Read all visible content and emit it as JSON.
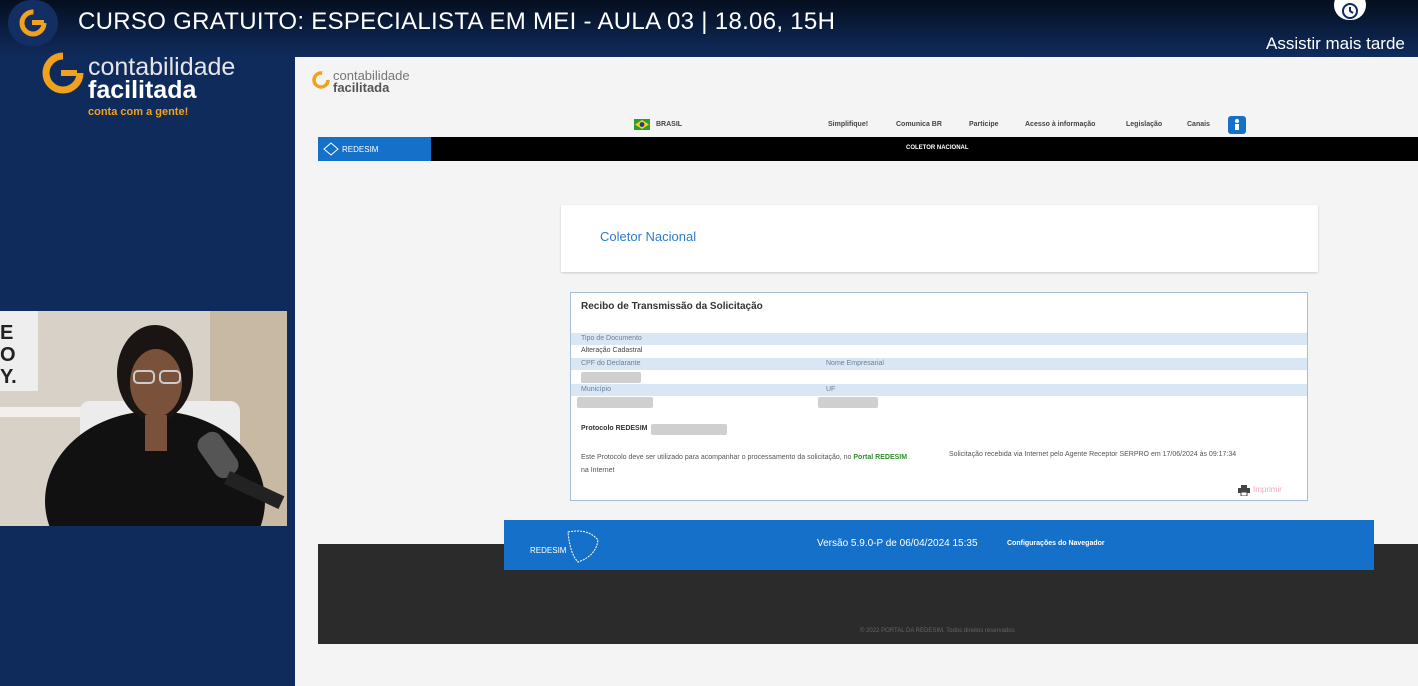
{
  "video": {
    "title": "CURSO GRATUITO: ESPECIALISTA EM MEI - AULA 03 | 18.06, 15H",
    "watch_later": "Assistir mais tarde"
  },
  "brand": {
    "line1": "contabilidade",
    "line2": "facilitada",
    "tagline": "conta com a gente!",
    "accent_color": "#f0a21c"
  },
  "share": {
    "logo_line1": "contabilidade",
    "logo_line2": "facilitada",
    "gov": {
      "country": "BRASIL",
      "links": [
        "Simplifique!",
        "Comunica BR",
        "Participe",
        "Acesso à informação",
        "Legislação",
        "Canais"
      ]
    },
    "redesim_tab": "REDESIM",
    "coletor_top": "COLETOR NACIONAL",
    "page_title": "Coletor Nacional",
    "recibo": {
      "heading": "Recibo de Transmissão da Solicitação",
      "tipo_label": "Tipo de Documento",
      "tipo_value": "Alteração Cadastral",
      "cpf_label": "CPF do Declarante",
      "nome_label": "Nome Empresarial",
      "municipio_label": "Município",
      "uf_label": "UF",
      "protocolo_label": "Protocolo REDESIM",
      "info_pre": "Este Protocolo deve ser utilizado para acompanhar o processamento da solicitação, no",
      "info_link": "Portal REDESIM",
      "info_post": "na Internet",
      "recebida": "Solicitação recebida via Internet pelo Agente Receptor SERPRO em 17/06/2024 às 09:17:34",
      "imprimir": "Imprimir"
    },
    "footer": {
      "versao": "Versão 5.9.0-P de 06/04/2024 15:35",
      "config": "Configurações do Navegador",
      "copyright": "© 2022 PORTAL DA REDESIM. Todos direitos reservados"
    }
  },
  "colors": {
    "navy": "#0f2b5c",
    "redesim_blue": "#1570c9"
  }
}
